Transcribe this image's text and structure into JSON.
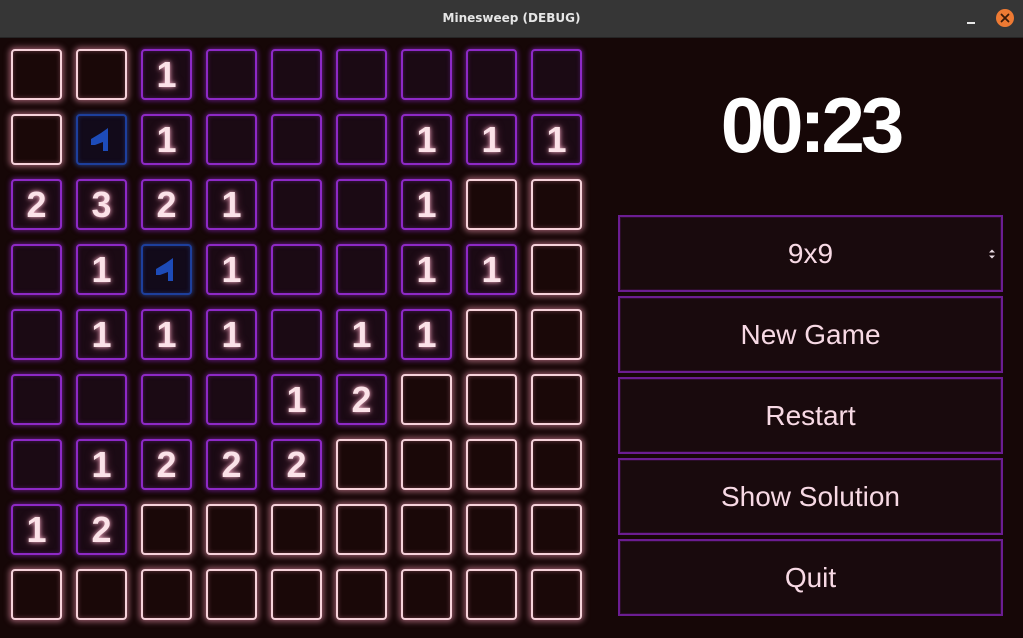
{
  "window": {
    "title": "Minesweep (DEBUG)"
  },
  "timer": "00:23",
  "board": {
    "rows": 9,
    "cols": 9,
    "legend": "H = hidden, F = flagged, E = revealed empty, digits = revealed count",
    "grid": [
      [
        "H",
        "H",
        "1",
        "E",
        "E",
        "E",
        "E",
        "E",
        "E"
      ],
      [
        "H",
        "F",
        "1",
        "E",
        "E",
        "E",
        "1",
        "1",
        "1"
      ],
      [
        "2",
        "3",
        "2",
        "1",
        "E",
        "E",
        "1",
        "H",
        "H"
      ],
      [
        "E",
        "1",
        "F",
        "1",
        "E",
        "E",
        "1",
        "1",
        "H"
      ],
      [
        "E",
        "1",
        "1",
        "1",
        "E",
        "1",
        "1",
        "H",
        "H"
      ],
      [
        "E",
        "E",
        "E",
        "E",
        "1",
        "2",
        "H",
        "H",
        "H"
      ],
      [
        "E",
        "1",
        "2",
        "2",
        "2",
        "H",
        "H",
        "H",
        "H"
      ],
      [
        "1",
        "2",
        "H",
        "H",
        "H",
        "H",
        "H",
        "H",
        "H"
      ],
      [
        "H",
        "H",
        "H",
        "H",
        "H",
        "H",
        "H",
        "H",
        "H"
      ]
    ]
  },
  "controls": {
    "size_select": "9x9",
    "new_game": "New Game",
    "restart": "Restart",
    "show_solution": "Show Solution",
    "quit": "Quit"
  },
  "colors": {
    "background": "#160707",
    "revealed_border": "#8d29c6",
    "hidden_border": "#f6d2da",
    "flag": "#1d4bb8",
    "button_border": "#6b1d92",
    "button_text": "#f7d9e4"
  },
  "icons": {
    "flag": "flag-icon",
    "close": "close-icon",
    "minimize": "minimize-icon"
  }
}
